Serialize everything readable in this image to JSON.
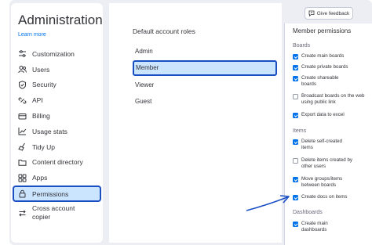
{
  "sidebar": {
    "title": "Administration",
    "learn_more": "Learn more",
    "items": [
      {
        "label": "Customization",
        "icon": "sliders-icon"
      },
      {
        "label": "Users",
        "icon": "users-icon"
      },
      {
        "label": "Security",
        "icon": "shield-icon"
      },
      {
        "label": "API",
        "icon": "api-icon"
      },
      {
        "label": "Billing",
        "icon": "card-icon"
      },
      {
        "label": "Usage stats",
        "icon": "chart-icon"
      },
      {
        "label": "Tidy Up",
        "icon": "broom-icon"
      },
      {
        "label": "Content directory",
        "icon": "folder-icon"
      },
      {
        "label": "Apps",
        "icon": "apps-icon"
      },
      {
        "label": "Permissions",
        "icon": "lock-icon"
      },
      {
        "label": "Cross account copier",
        "icon": "transfer-icon"
      }
    ]
  },
  "main": {
    "roles_title": "Default account roles",
    "roles": [
      "Admin",
      "Member",
      "Viewer",
      "Guest"
    ]
  },
  "feedback": {
    "label": "Give feedback",
    "icon": "feedback-icon"
  },
  "member_permissions": {
    "title": "Member permissions",
    "sections": [
      {
        "name": "Boards",
        "items": [
          {
            "label": "Create main boards",
            "checked": true
          },
          {
            "label": "Create private boards",
            "checked": true
          },
          {
            "label": "Create shareable boards",
            "checked": true
          },
          {
            "label": "Broadcast boards on the web using public link",
            "checked": false
          },
          {
            "label": "Export data to excel",
            "checked": true
          }
        ]
      },
      {
        "name": "Items",
        "items": [
          {
            "label": "Delete self-created items",
            "checked": true
          },
          {
            "label": "Delete items created by other users",
            "checked": false
          },
          {
            "label": "Move groups/items between boards",
            "checked": true
          },
          {
            "label": "Create docs on items",
            "checked": true
          }
        ]
      },
      {
        "name": "Dashboards",
        "items": [
          {
            "label": "Create main dashboards",
            "checked": true
          }
        ]
      }
    ]
  },
  "colors": {
    "accent": "#0073ea",
    "highlight_border": "#1a4fc4",
    "highlight_fill": "#cce5ff",
    "frame": "#eceef4"
  }
}
